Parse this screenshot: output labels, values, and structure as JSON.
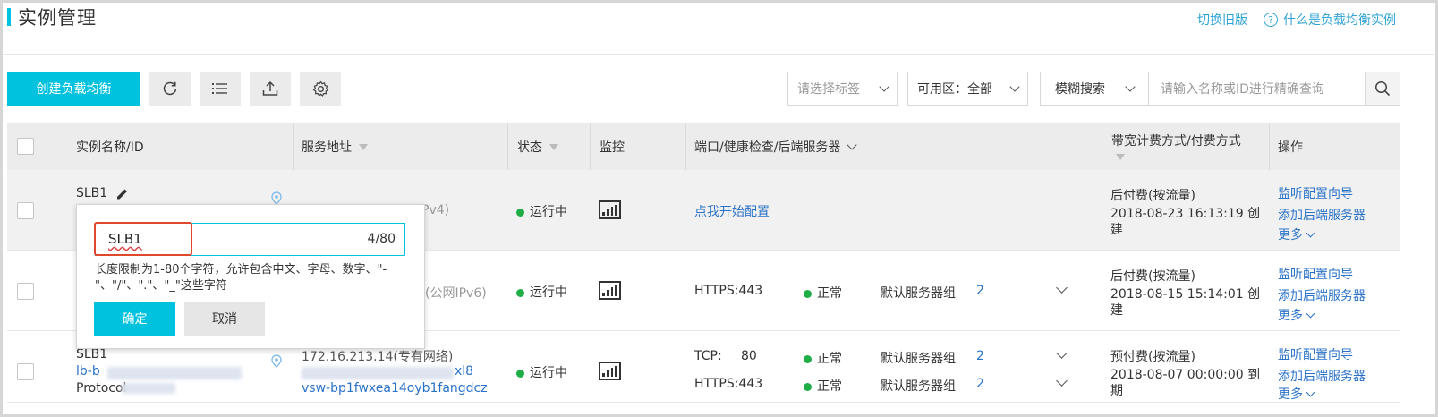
{
  "header": {
    "title": "实例管理",
    "switch_link": "切换旧版",
    "help_link": "什么是负载均衡实例",
    "help_icon": "?"
  },
  "toolbar": {
    "create_label": "创建负载均衡",
    "tag_placeholder": "请选择标签",
    "zone_label": "可用区：全部",
    "search_mode": "模糊搜索",
    "search_placeholder": "请输入名称或ID进行精确查询"
  },
  "table": {
    "columns": [
      "实例名称/ID",
      "服务地址",
      "状态",
      "监控",
      "端口/健康检查/后端服务器",
      "带宽计费方式/付费方式",
      "操作"
    ],
    "rows": [
      {
        "name": "SLB1",
        "address_suffix": "Pv4)",
        "status": "运行中",
        "port_link": "点我开始配置",
        "billing": "后付费(按流量)",
        "billing_time": "2018-08-23 16:13:19 创",
        "billing_time2": "建",
        "op1": "监听配置向导",
        "op2": "添加后端服务器",
        "op3": "更多"
      },
      {
        "address_suffix": "(公网IPv6)",
        "status": "运行中",
        "port": "HTTPS:443",
        "health": "正常",
        "group": "默认服务器组",
        "group_count": "2",
        "billing": "后付费(按流量)",
        "billing_time": "2018-08-15 15:14:01 创",
        "billing_time2": "建",
        "op1": "监听配置向导",
        "op2": "添加后端服务器",
        "op3": "更多"
      },
      {
        "name": "SLB1",
        "id_prefix": "lb-b",
        "id_suffix": "Protocol",
        "address": "172.16.213.14(专有网络)",
        "addr_line2_suffix": "xl8",
        "addr_line3": "vsw-bp1fwxea14oyb1fangdcz",
        "status": "运行中",
        "port1_proto": "TCP:",
        "port1_num": "80",
        "health1": "正常",
        "group1": "默认服务器组",
        "group1_count": "2",
        "port2": "HTTPS:443",
        "health2": "正常",
        "group2": "默认服务器组",
        "group2_count": "2",
        "billing": "预付费(按流量)",
        "billing_time": "2018-08-07 00:00:00 到",
        "billing_time2": "期",
        "op1": "监听配置向导",
        "op2": "添加后端服务器",
        "op3": "更多"
      }
    ]
  },
  "popover": {
    "value": "SLB1",
    "counter": "4/80",
    "hint": "长度限制为1-80个字符，允许包含中文、字母、数字、\"-\"、\"/\"、\".\"、\"_\"这些字符",
    "ok_label": "确定",
    "cancel_label": "取消"
  },
  "colors": {
    "accent": "#00c1de",
    "link": "#2a72c8",
    "status_ok": "#1fae46",
    "highlight": "#e0482e"
  }
}
